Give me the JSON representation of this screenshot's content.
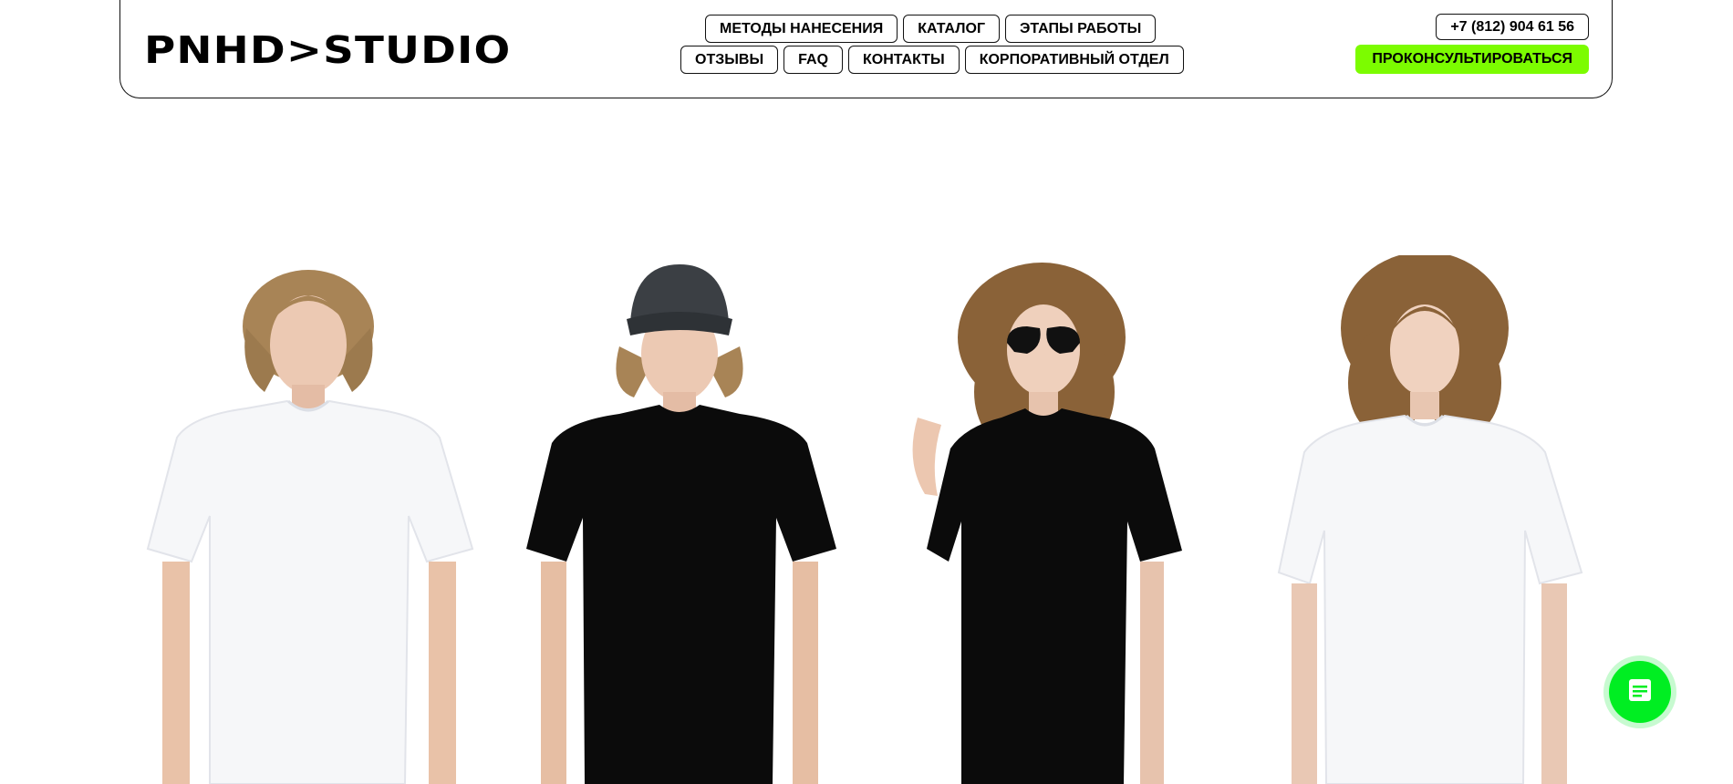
{
  "header": {
    "logo": "PNHD>STUDIO",
    "nav_row1": [
      "МЕТОДЫ НАНЕСЕНИЯ",
      "КАТАЛОГ",
      "ЭТАПЫ РАБОТЫ"
    ],
    "nav_row2": [
      "ОТЗЫВЫ",
      "FAQ",
      "КОНТАКТЫ",
      "КОРПОРАТИВНЫЙ ОТДЕЛ"
    ],
    "phone": "+7 (812) 904 61 56",
    "cta": "ПРОКОНСУЛЬТИРОВАТЬСЯ"
  },
  "colors": {
    "accent_green": "#7cfc00",
    "chat_green": "#00ee22",
    "border": "#111111"
  },
  "hero": {
    "models": [
      {
        "shirt": "white",
        "hair": "wavy",
        "accessory": "none"
      },
      {
        "shirt": "black",
        "hair": "wavy",
        "accessory": "cap"
      },
      {
        "shirt": "black",
        "hair": "curly",
        "accessory": "sunglasses"
      },
      {
        "shirt": "white",
        "hair": "curly",
        "accessory": "none"
      }
    ]
  },
  "chat": {
    "icon": "chat-icon"
  }
}
